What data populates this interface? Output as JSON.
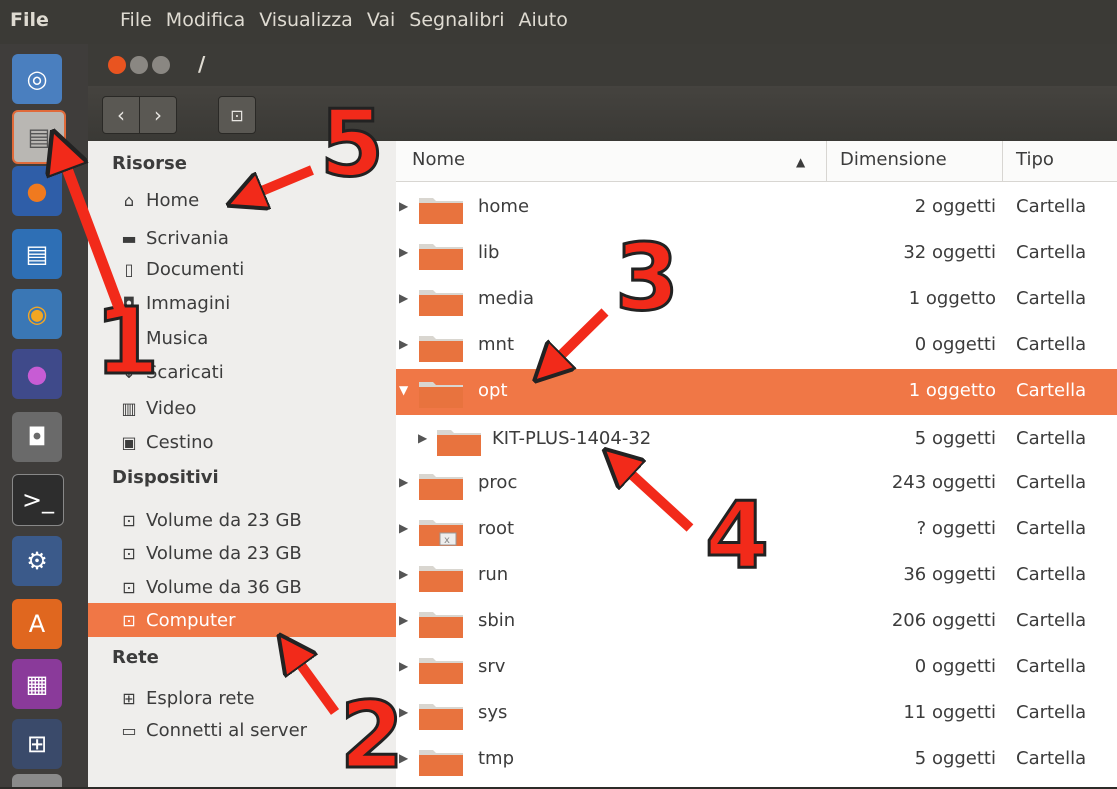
{
  "topbar": {
    "app_name": "File",
    "menu": [
      "File",
      "Modifica",
      "Visualizza",
      "Vai",
      "Segnalibri",
      "Aiuto"
    ]
  },
  "window": {
    "title": "/",
    "back_icon": "chevron-left-icon",
    "forward_icon": "chevron-right-icon",
    "location_icon": "drive-icon"
  },
  "launcher": {
    "icons": [
      "ubuntu-dash-icon",
      "files-icon",
      "firefox-icon",
      "writer-icon",
      "cd-burner-icon",
      "media-player-icon",
      "camera-icon",
      "terminal-icon",
      "settings-icon",
      "software-center-icon",
      "workspace-switcher-icon",
      "workspaces-icon",
      "trash-icon"
    ]
  },
  "sidebar": {
    "sections": [
      {
        "title": "Risorse",
        "items": [
          {
            "label": "Home",
            "icon": "home-icon"
          },
          {
            "label": "Scrivania",
            "icon": "desktop-folder-icon"
          },
          {
            "label": "Documenti",
            "icon": "document-icon"
          },
          {
            "label": "Immagini",
            "icon": "camera-icon"
          },
          {
            "label": "Musica",
            "icon": "music-icon"
          },
          {
            "label": "Scaricati",
            "icon": "download-icon"
          },
          {
            "label": "Video",
            "icon": "film-icon"
          },
          {
            "label": "Cestino",
            "icon": "trash-icon"
          }
        ]
      },
      {
        "title": "Dispositivi",
        "items": [
          {
            "label": "Volume da 23 GB",
            "icon": "drive-icon"
          },
          {
            "label": "Volume da 23 GB",
            "icon": "drive-icon"
          },
          {
            "label": "Volume da 36 GB",
            "icon": "drive-icon"
          },
          {
            "label": "Computer",
            "icon": "drive-icon",
            "selected": true
          }
        ]
      },
      {
        "title": "Rete",
        "items": [
          {
            "label": "Esplora rete",
            "icon": "network-icon"
          },
          {
            "label": "Connetti al server",
            "icon": "server-icon"
          }
        ]
      }
    ]
  },
  "columns": {
    "name": "Nome",
    "size": "Dimensione",
    "type": "Tipo",
    "sort_icon": "sort-ascending-icon"
  },
  "files": [
    {
      "name": "home",
      "size": "2 oggetti",
      "type": "Cartella"
    },
    {
      "name": "lib",
      "size": "32 oggetti",
      "type": "Cartella"
    },
    {
      "name": "media",
      "size": "1 oggetto",
      "type": "Cartella"
    },
    {
      "name": "mnt",
      "size": "0 oggetti",
      "type": "Cartella"
    },
    {
      "name": "opt",
      "size": "1 oggetto",
      "type": "Cartella",
      "selected": true,
      "expanded": true
    },
    {
      "name": "KIT-PLUS-1404-32",
      "size": "5 oggetti",
      "type": "Cartella",
      "child": true
    },
    {
      "name": "proc",
      "size": "243 oggetti",
      "type": "Cartella"
    },
    {
      "name": "root",
      "size": "? oggetti",
      "type": "Cartella",
      "locked": true
    },
    {
      "name": "run",
      "size": "36 oggetti",
      "type": "Cartella"
    },
    {
      "name": "sbin",
      "size": "206 oggetti",
      "type": "Cartella"
    },
    {
      "name": "srv",
      "size": "0 oggetti",
      "type": "Cartella"
    },
    {
      "name": "sys",
      "size": "11 oggetti",
      "type": "Cartella"
    },
    {
      "name": "tmp",
      "size": "5 oggetti",
      "type": "Cartella"
    }
  ],
  "annotations": {
    "n1": "1",
    "n2": "2",
    "n3": "3",
    "n4": "4",
    "n5": "5",
    "color": "#f22a1a"
  },
  "colors": {
    "accent": "#f07746",
    "folder": "#e8733e"
  }
}
